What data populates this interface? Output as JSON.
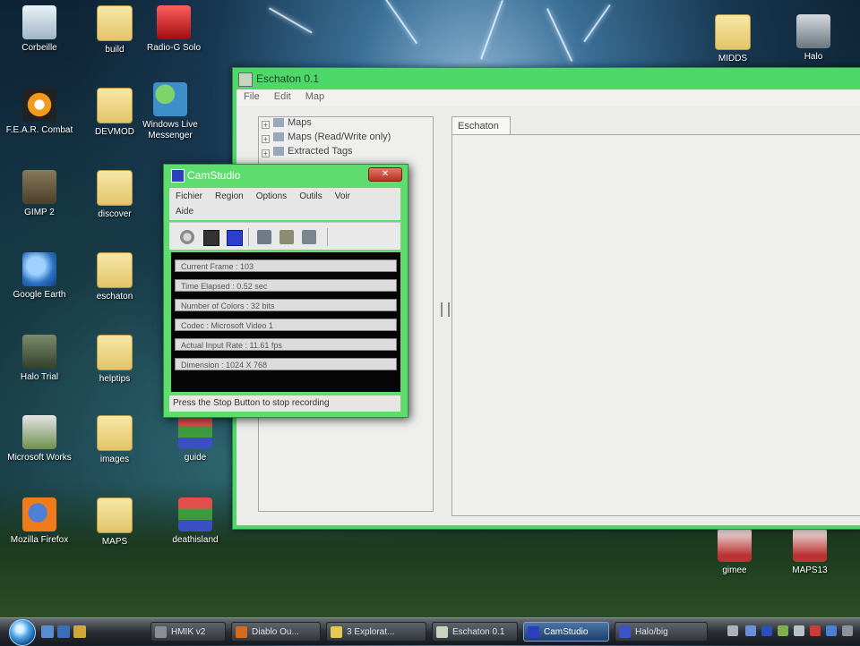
{
  "desktop_icons": [
    {
      "label": "Corbeille",
      "icon": "recycle-bin-icon"
    },
    {
      "label": "build",
      "icon": "folder-icon"
    },
    {
      "label": "Radio-G Solo",
      "icon": "radio-icon"
    },
    {
      "label": "F.E.A.R. Combat",
      "icon": "fear-game-icon"
    },
    {
      "label": "DEVMOD",
      "icon": "folder-icon"
    },
    {
      "label": "Windows Live Messenger",
      "icon": "messenger-icon"
    },
    {
      "label": "GIMP 2",
      "icon": "gimp-icon"
    },
    {
      "label": "discover",
      "icon": "folder-icon"
    },
    {
      "label": "Google Earth",
      "icon": "google-earth-icon"
    },
    {
      "label": "eschaton",
      "icon": "folder-icon"
    },
    {
      "label": "Halo Trial",
      "icon": "halo-icon"
    },
    {
      "label": "helptips",
      "icon": "folder-icon"
    },
    {
      "label": "Microsoft Works",
      "icon": "works-icon"
    },
    {
      "label": "images",
      "icon": "folder-icon"
    },
    {
      "label": "guide",
      "icon": "package-icon"
    },
    {
      "label": "Mozilla Firefox",
      "icon": "firefox-icon"
    },
    {
      "label": "MAPS",
      "icon": "folder-icon"
    },
    {
      "label": "deathisland",
      "icon": "package-icon"
    },
    {
      "label": "MIDDS",
      "icon": "folder-icon"
    },
    {
      "label": "Halo",
      "icon": "microphone-icon"
    },
    {
      "label": "gimee",
      "icon": "device-icon"
    },
    {
      "label": "MAPS13",
      "icon": "device-icon"
    }
  ],
  "eschaton": {
    "title": "Eschaton 0.1",
    "menu": [
      "File",
      "Edit",
      "Map"
    ],
    "tree": [
      "Maps",
      "Maps (Read/Write only)",
      "Extracted Tags"
    ],
    "tab_label": "Eschaton"
  },
  "camstudio": {
    "title": "CamStudio",
    "close_label": "✕",
    "menu": [
      "Fichier",
      "Region",
      "Options",
      "Outils",
      "Voir",
      "Aide"
    ],
    "stats": [
      "Current Frame : 103",
      "Time Elapsed : 0.52 sec",
      "Number of Colors : 32 bits",
      "Codec : Microsoft Video 1",
      "Actual Input Rate : 11.61 fps",
      "Dimension : 1024 X 768"
    ],
    "status": "Press the Stop Button to stop recording"
  },
  "taskbar": {
    "tasks": [
      {
        "label": "HMIK v2"
      },
      {
        "label": "Diablo Ou..."
      },
      {
        "label": "3 Explorat..."
      },
      {
        "label": "Eschaton 0.1"
      },
      {
        "label": "CamStudio",
        "active": true
      },
      {
        "label": "Halo/big"
      }
    ]
  }
}
